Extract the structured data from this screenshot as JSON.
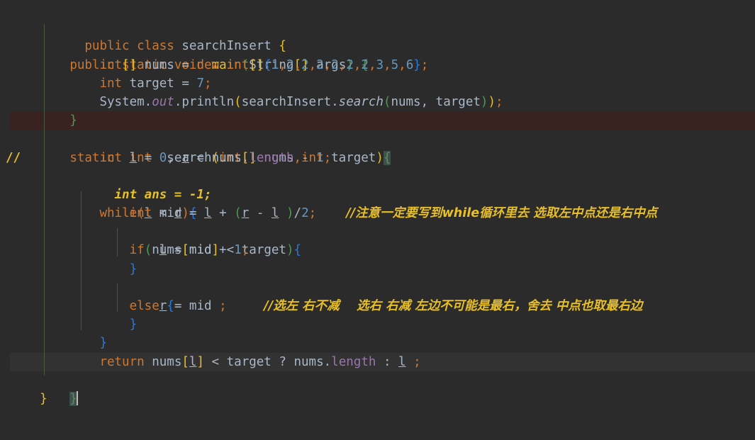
{
  "editor": {
    "language": "java",
    "background": "#2b2b2b",
    "error_line_background": "#3a2221",
    "caret_line_background": "#323232",
    "default_text_color": "#a9b7c6",
    "keyword_color": "#cc7832",
    "number_color": "#6897bb",
    "comment_color": "#e8bf26",
    "field_color": "#9876aa",
    "brace_yellow": "#e8bf26",
    "brace_green": "#4e9a51",
    "brace_blue": "#287bde",
    "match_brace_background": "#3b514d"
  },
  "gutter": {
    "fold_icon": "fold-arrow-icon",
    "comment_marker": "//"
  },
  "code": {
    "line01": {
      "t1": "public",
      "t2": " ",
      "t3": "class",
      "t4": " ",
      "t5": "searchInsert",
      "t6": " ",
      "t7": "{"
    },
    "line02": {
      "indent": "    ",
      "t1": "public",
      "t2": " ",
      "t3": "static",
      "t4": " ",
      "t5": "void",
      "t6": " ",
      "t7": "main",
      "t8": "(",
      "t9": "String",
      "t10": "[]",
      "t11": " args",
      "t12": ")",
      "t13": " ",
      "t14": "{"
    },
    "line03": {
      "indent": "        ",
      "t1": "int",
      "t2": "[]",
      "t3": " nums ",
      "t4": "=",
      "t5": " ",
      "t6": "new",
      "t7": " ",
      "t8": "int",
      "t9": "[]",
      "t10": "{",
      "t11": "1",
      "c1": ",",
      "t12": "2",
      "c2": ",",
      "t13": "2",
      "c3": ",",
      "t14": "2",
      "c4": ",",
      "t15": "2",
      "c5": ",",
      "t16": "2",
      "c6": ",",
      "t17": "2",
      "c7": ",",
      "t18": "3",
      "c8": ",",
      "t19": "5",
      "c9": ",",
      "t20": "6",
      "t21": "}",
      "t22": ";"
    },
    "line04": {
      "indent": "        ",
      "t1": "int",
      "t2": " target ",
      "t3": "=",
      "t4": " ",
      "t5": "7",
      "t6": ";"
    },
    "line05": {
      "indent": "        ",
      "t1": "System",
      "t2": ".",
      "t3": "out",
      "t4": ".",
      "t5": "println",
      "t6": "(",
      "t7": "searchInsert",
      "t8": ".",
      "t9": "search",
      "t10": "(",
      "t11": "nums",
      "t12": ", ",
      "t13": "target",
      "t14": ")",
      "t15": ")",
      "t16": ";"
    },
    "line06": {
      "indent": "    ",
      "t1": "}"
    },
    "line07": {
      "indent": "    ",
      "t1": "static",
      "t2": "  ",
      "t3": "int",
      "t4": "  ",
      "t5": "search",
      "t6": "(",
      "t7": "int",
      "t8": "[]",
      "t9": " nums",
      "t10": ",",
      "t11": "int",
      "t12": " target",
      "t13": ")",
      "t14": "{"
    },
    "line08": {
      "indent": "        ",
      "t1": "int",
      "t2": " ",
      "t3": "l",
      "t4": " ",
      "t5": "=",
      "t6": " ",
      "t7": "0",
      "t8": ", ",
      "t9": "r",
      "t10": " ",
      "t11": "=",
      "t12": " nums",
      "t13": ".",
      "t14": "length",
      "t15": " ",
      "t16": "-",
      "t17": " ",
      "t18": "1",
      "t19": ";"
    },
    "line09": {
      "gutter_marker": "//",
      "indent": "          ",
      "text": "int ans = -1;"
    },
    "line10": {
      "indent": "        ",
      "t1": "while",
      "t2": "(",
      "t3": "l",
      "t4": " ",
      "t5": "<",
      "t6": " ",
      "t7": "r",
      "t8": ")",
      "t9": "{"
    },
    "line11": {
      "indent": "            ",
      "t1": "int",
      "t2": " mid ",
      "t3": "=",
      "t4": " ",
      "t5": "l",
      "t6": " ",
      "t7": "+",
      "t8": " ",
      "t9": "(",
      "t10": "r",
      "t11": " ",
      "t12": "-",
      "t13": " ",
      "t14": "l",
      "t15": " ",
      "t16": ")",
      "t17": "/",
      "t18": "2",
      "t19": ";",
      "spacer": "    ",
      "comment": "//注意一定要写到while循环里去 选取左中点还是右中点"
    },
    "line12": {
      "indent": "            ",
      "t1": "if",
      "t2": "(",
      "t3": "nums",
      "t4": "[",
      "t5": "mid",
      "t6": "]",
      "t7": " ",
      "t8": "<",
      "t9": " target",
      "t10": ")",
      "t11": "{"
    },
    "line13": {
      "indent": "                ",
      "t1": "l",
      "t2": " ",
      "t3": "=",
      "t4": " mid ",
      "t5": "+",
      "t6": " ",
      "t7": "1",
      "t8": ";"
    },
    "line14": {
      "indent": "            ",
      "t1": "}"
    },
    "line15": {
      "indent": "            ",
      "t1": "else",
      "t2": " ",
      "t3": "{"
    },
    "line16": {
      "indent": "                ",
      "t1": "r",
      "t2": " ",
      "t3": "=",
      "t4": " mid ",
      "t5": ";",
      "spacer": "     ",
      "comment": "//选左 右不减    选右 右减 左边不可能是最右，舍去 中点也取最右边"
    },
    "line17": {
      "indent": "            ",
      "t1": "}"
    },
    "line18": {
      "indent": "        ",
      "t1": "}"
    },
    "line19": {
      "indent": "        ",
      "t1": "return",
      "t2": " nums",
      "t3": "[",
      "t4": "l",
      "t5": "]",
      "t6": " ",
      "t7": "<",
      "t8": " target ",
      "t9": "?",
      "t10": " nums",
      "t11": ".",
      "t12": "length",
      "t13": " ",
      "t14": ":",
      "t15": " ",
      "t16": "l",
      "t17": " ",
      "t18": ";"
    },
    "line20": {
      "indent": "    ",
      "t1": "}"
    },
    "line21": {
      "indent": "",
      "t1": "}"
    }
  }
}
